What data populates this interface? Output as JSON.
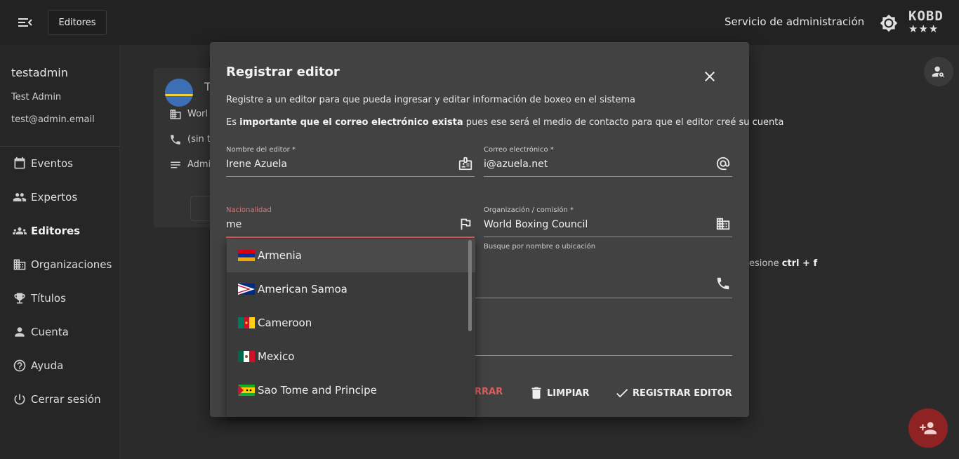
{
  "topbar": {
    "section_label": "Editores",
    "service_title": "Servicio de administración",
    "logo_text": "KOBD",
    "logo_stars": "★★★"
  },
  "sidebar": {
    "username": "testadmin",
    "full_name": "Test Admin",
    "email": "test@admin.email",
    "items": [
      {
        "label": "Eventos",
        "icon": "calendar-icon"
      },
      {
        "label": "Expertos",
        "icon": "people-icon"
      },
      {
        "label": "Editores",
        "icon": "groups-icon",
        "active": true
      },
      {
        "label": "Organizaciones",
        "icon": "building-icon"
      },
      {
        "label": "Títulos",
        "icon": "trophy-icon"
      },
      {
        "label": "Cuenta",
        "icon": "person-icon"
      },
      {
        "label": "Ayuda",
        "icon": "help-icon"
      },
      {
        "label": "Cerrar sesión",
        "icon": "power-icon"
      }
    ]
  },
  "background": {
    "card_title": "T",
    "card_org": "Worl",
    "card_phone": "(sin t",
    "card_role": "Admi",
    "hint_text": "esione ",
    "hint_shortcut": "ctrl + f"
  },
  "dialog": {
    "title": "Registrar editor",
    "description": "Registre a un editor para que pueda ingresar y editar información de boxeo en el sistema",
    "note_prefix": "Es ",
    "note_bold": "importante que el correo electrónico exista",
    "note_suffix": " pues ese será el medio de contacto para que el editor creé su cuenta",
    "fields": {
      "name": {
        "label": "Nombre del editor *",
        "value": "Irene Azuela"
      },
      "email": {
        "label": "Correo electrónico *",
        "value": "i@azuela.net"
      },
      "nationality": {
        "label": "Nacionalidad",
        "value": "me"
      },
      "organization": {
        "label": "Organización / comisión *",
        "value": "World Boxing Council",
        "hint": "Busque por nombre o ubicación"
      }
    },
    "dropdown": [
      {
        "label": "Armenia",
        "flag": "armenia"
      },
      {
        "label": "American Samoa",
        "flag": "american-samoa"
      },
      {
        "label": "Cameroon",
        "flag": "cameroon"
      },
      {
        "label": "Mexico",
        "flag": "mexico"
      },
      {
        "label": "Sao Tome and Principe",
        "flag": "sao-tome"
      }
    ],
    "actions": {
      "close_label": "RRAR",
      "clear_label": "LIMPIAR",
      "submit_label": "REGISTRAR EDITOR"
    }
  },
  "colors": {
    "accent_error": "#e05c5c",
    "fab": "#8f2323",
    "dialog_bg": "#424242"
  }
}
